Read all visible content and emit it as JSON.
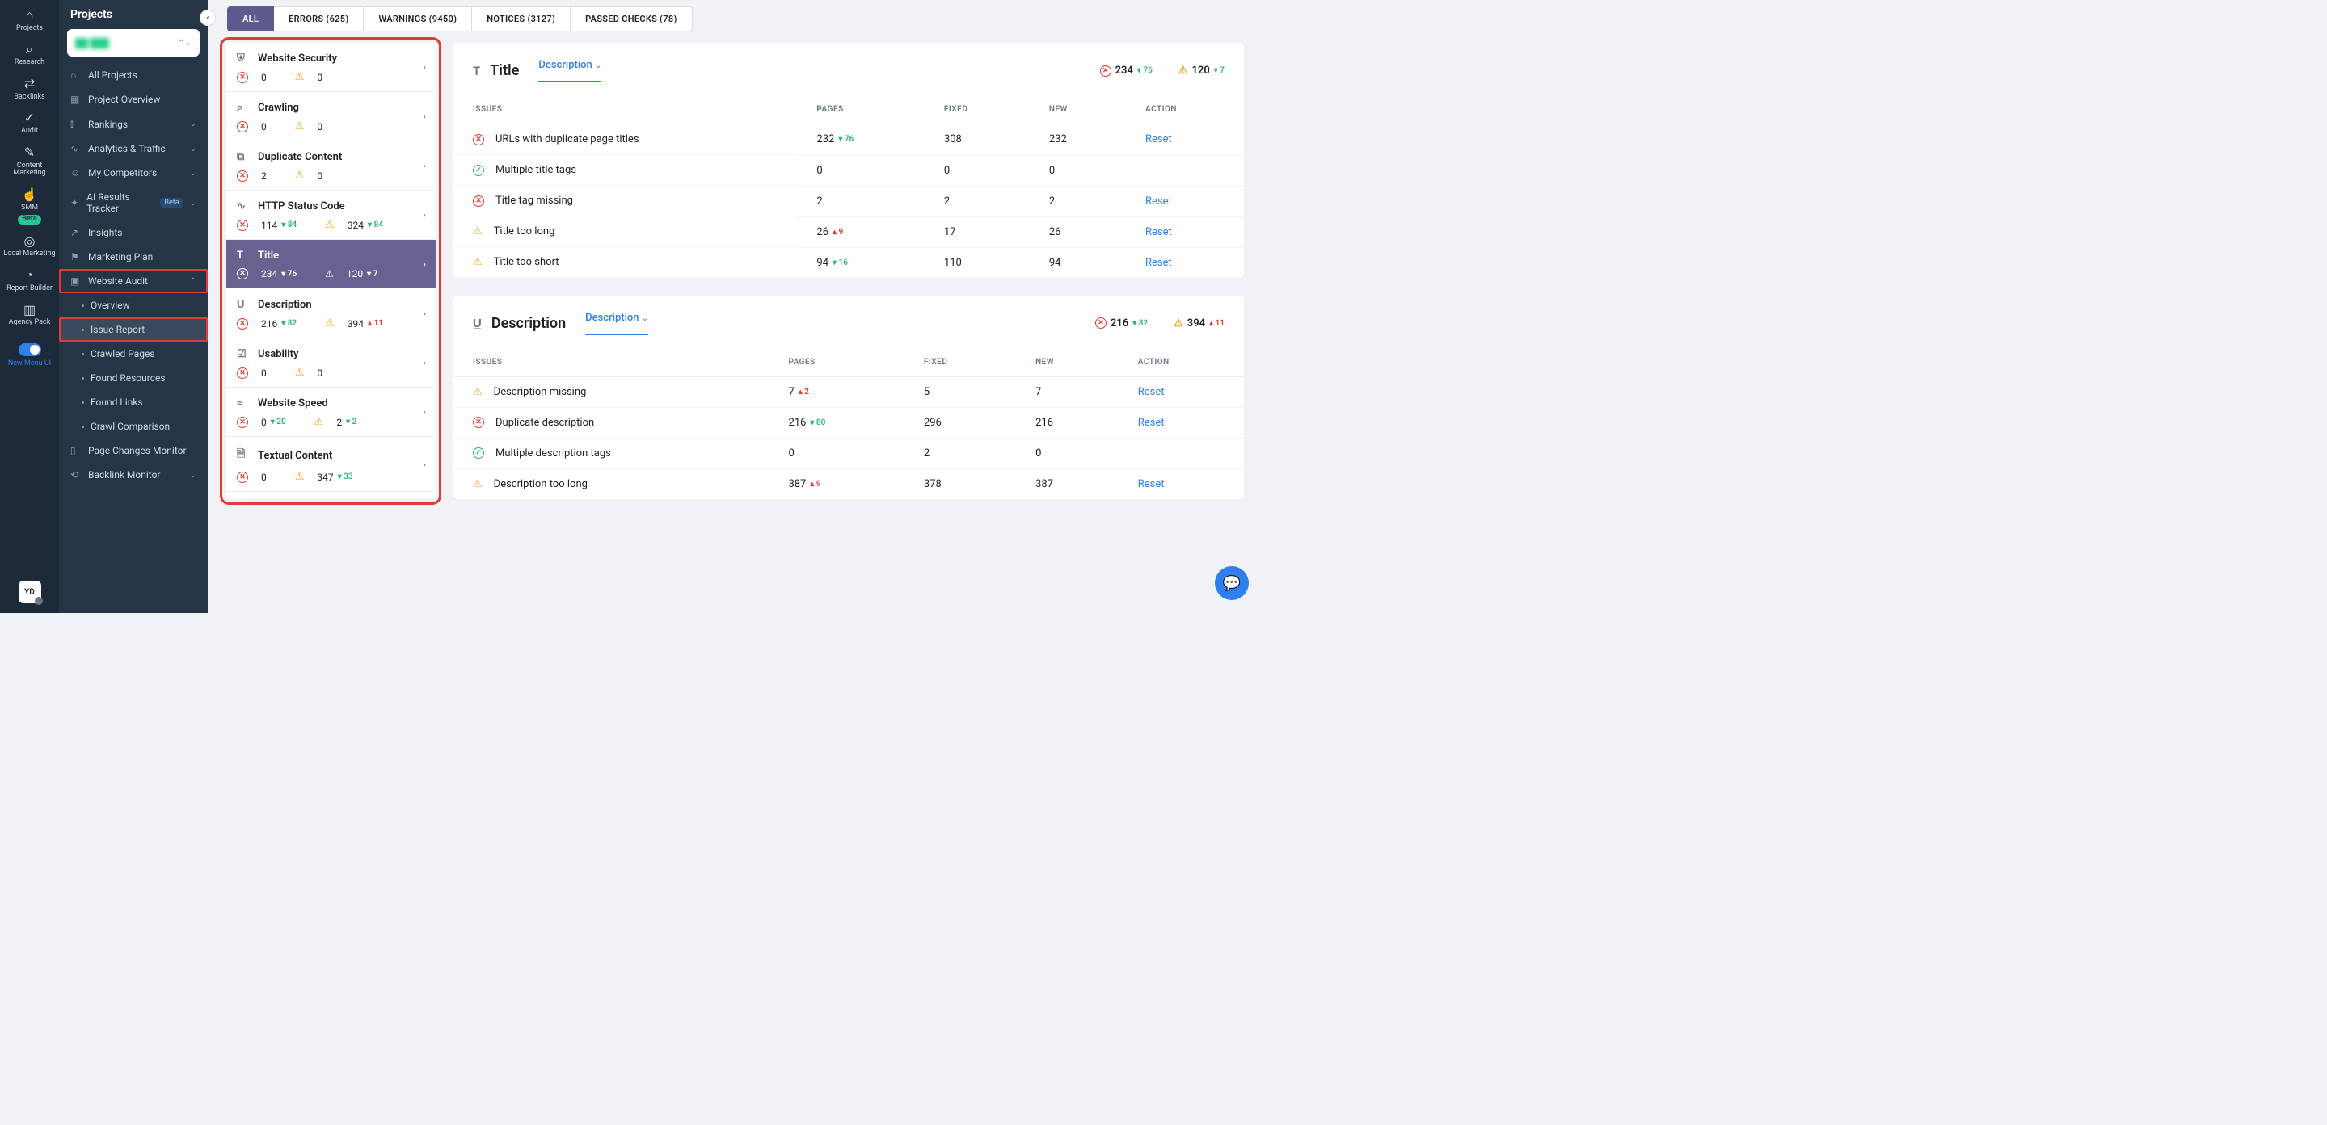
{
  "rail": {
    "items": [
      {
        "label": "Projects",
        "icon": "⌂",
        "active": true
      },
      {
        "label": "Research",
        "icon": "⌕"
      },
      {
        "label": "Backlinks",
        "icon": "⇄"
      },
      {
        "label": "Audit",
        "icon": "✓"
      },
      {
        "label": "Content Marketing",
        "icon": "✎"
      },
      {
        "label": "SMM",
        "icon": "☝",
        "beta": true
      },
      {
        "label": "Local Marketing",
        "icon": "◎"
      },
      {
        "label": "Report Builder",
        "icon": "◔"
      },
      {
        "label": "Agency Pack",
        "icon": "▥"
      }
    ],
    "new_menu": "New Menu UI",
    "avatar": "YD"
  },
  "sidebar": {
    "title": "Projects",
    "nav": [
      {
        "label": "All Projects",
        "icon": "⌂"
      },
      {
        "label": "Project Overview",
        "icon": "▦"
      },
      {
        "label": "Rankings",
        "icon": "⫾",
        "chev": true
      },
      {
        "label": "Analytics & Traffic",
        "icon": "∿",
        "chev": true
      },
      {
        "label": "My Competitors",
        "icon": "☺",
        "chev": true
      },
      {
        "label": "AI Results Tracker",
        "icon": "✦",
        "chev": true,
        "beta": true
      },
      {
        "label": "Insights",
        "icon": "↗"
      },
      {
        "label": "Marketing Plan",
        "icon": "⚑"
      },
      {
        "label": "Website Audit",
        "icon": "▣",
        "chev": true,
        "hl": true,
        "open": true,
        "sub": [
          {
            "label": "Overview"
          },
          {
            "label": "Issue Report",
            "hl": true
          },
          {
            "label": "Crawled Pages"
          },
          {
            "label": "Found Resources"
          },
          {
            "label": "Found Links"
          },
          {
            "label": "Crawl Comparison"
          }
        ]
      },
      {
        "label": "Page Changes Monitor",
        "icon": "▯"
      },
      {
        "label": "Backlink Monitor",
        "icon": "⟲",
        "chev": true
      }
    ]
  },
  "tabs": [
    {
      "label": "ALL",
      "on": true
    },
    {
      "label": "ERRORS (625)"
    },
    {
      "label": "WARNINGS (9450)"
    },
    {
      "label": "NOTICES (3127)"
    },
    {
      "label": "PASSED CHECKS (78)"
    }
  ],
  "issues": [
    {
      "title": "Website Security",
      "icon": "⛨",
      "err": "0",
      "warn": "0"
    },
    {
      "title": "Crawling",
      "icon": "⌕",
      "err": "0",
      "warn": "0"
    },
    {
      "title": "Duplicate Content",
      "icon": "⧉",
      "err": "2",
      "warn": "0"
    },
    {
      "title": "HTTP Status Code",
      "icon": "∿",
      "err": "114",
      "err_d": "▾ 84",
      "warn": "324",
      "warn_d": "▾ 84"
    },
    {
      "title": "Title",
      "icon": "T",
      "err": "234",
      "err_d": "▾ 76",
      "warn": "120",
      "warn_d": "▾ 7",
      "active": true
    },
    {
      "title": "Description",
      "icon": "U̲",
      "err": "216",
      "err_d": "▾ 82",
      "warn": "394",
      "warn_d": "▴ 11",
      "warn_up": true
    },
    {
      "title": "Usability",
      "icon": "☑",
      "err": "0",
      "warn": "0"
    },
    {
      "title": "Website Speed",
      "icon": "≈",
      "err": "0",
      "err_d": "▾ 20",
      "warn": "2",
      "warn_d": "▾ 2"
    },
    {
      "title": "Textual Content",
      "icon": "🗎",
      "err": "0",
      "warn": "347",
      "warn_d": "▾ 33"
    }
  ],
  "panels": [
    {
      "icon": "T",
      "title": "Title",
      "dd": "Description",
      "err": "234",
      "err_d": "▾ 76",
      "warn": "120",
      "warn_d": "▾ 7",
      "cols": [
        "ISSUES",
        "PAGES",
        "FIXED",
        "NEW",
        "ACTION"
      ],
      "rows": [
        {
          "sev": "err",
          "name": "URLs with duplicate page titles",
          "pages": "232",
          "pages_d": "▾ 76",
          "fixed": "308",
          "new": "232",
          "reset": true
        },
        {
          "sev": "ok",
          "name": "Multiple title tags",
          "pages": "0",
          "fixed": "0",
          "new": "0"
        },
        {
          "sev": "err",
          "name": "Title tag missing",
          "pages": "2",
          "fixed": "2",
          "new": "2",
          "reset": true
        },
        {
          "sev": "warn",
          "name": "Title too long",
          "pages": "26",
          "pages_d": "▴ 9",
          "pages_up": true,
          "fixed": "17",
          "new": "26",
          "reset": true
        },
        {
          "sev": "warn",
          "name": "Title too short",
          "pages": "94",
          "pages_d": "▾ 16",
          "fixed": "110",
          "new": "94",
          "reset": true
        }
      ]
    },
    {
      "icon": "U̲",
      "title": "Description",
      "dd": "Description",
      "err": "216",
      "err_d": "▾ 82",
      "warn": "394",
      "warn_d": "▴ 11",
      "warn_up": true,
      "cols": [
        "ISSUES",
        "PAGES",
        "FIXED",
        "NEW",
        "ACTION"
      ],
      "rows": [
        {
          "sev": "warn",
          "name": "Description missing",
          "pages": "7",
          "pages_d": "▴ 2",
          "pages_up": true,
          "fixed": "5",
          "new": "7",
          "reset": true
        },
        {
          "sev": "err",
          "name": "Duplicate description",
          "pages": "216",
          "pages_d": "▾ 80",
          "fixed": "296",
          "new": "216",
          "reset": true
        },
        {
          "sev": "ok",
          "name": "Multiple description tags",
          "pages": "0",
          "fixed": "2",
          "new": "0"
        },
        {
          "sev": "warn",
          "name": "Description too long",
          "pages": "387",
          "pages_d": "▴ 9",
          "pages_up": true,
          "fixed": "378",
          "new": "387",
          "reset": true
        }
      ]
    }
  ],
  "reset_label": "Reset"
}
